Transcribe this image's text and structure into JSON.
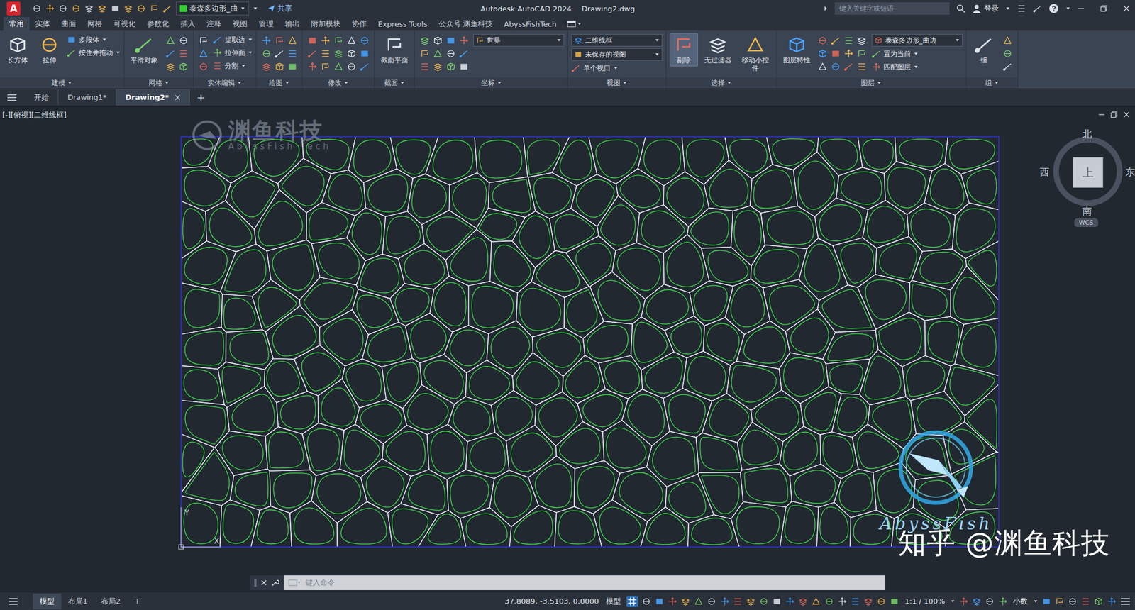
{
  "window": {
    "app_letter": "A",
    "app_title": "Autodesk AutoCAD 2024",
    "document": "Drawing2.dwg"
  },
  "quick_access": {
    "layer": "泰森多边形_曲",
    "share": "共享"
  },
  "search": {
    "placeholder": "键入关键字或短语"
  },
  "account": {
    "label": "登录"
  },
  "ribbon_tabs": [
    {
      "label": "常用",
      "selected": true
    },
    {
      "label": "实体",
      "selected": false
    },
    {
      "label": "曲面",
      "selected": false
    },
    {
      "label": "网格",
      "selected": false
    },
    {
      "label": "可视化",
      "selected": false
    },
    {
      "label": "参数化",
      "selected": false
    },
    {
      "label": "插入",
      "selected": false
    },
    {
      "label": "注释",
      "selected": false
    },
    {
      "label": "视图",
      "selected": false
    },
    {
      "label": "管理",
      "selected": false
    },
    {
      "label": "输出",
      "selected": false
    },
    {
      "label": "附加模块",
      "selected": false
    },
    {
      "label": "协作",
      "selected": false
    },
    {
      "label": "Express Tools",
      "selected": false
    },
    {
      "label": "公众号 渊鱼科技",
      "selected": false
    },
    {
      "label": "AbyssFishTech",
      "selected": false
    }
  ],
  "panels": [
    {
      "title": "建模",
      "tools": [
        {
          "kind": "large",
          "label": "长方体",
          "active": false
        },
        {
          "kind": "large",
          "label": "拉伸",
          "active": false
        },
        {
          "kind": "small",
          "label": "多段体"
        },
        {
          "kind": "small",
          "label": "按住并拖动"
        }
      ]
    },
    {
      "title": "网格",
      "tools": [
        {
          "kind": "large",
          "label": "平滑对象",
          "active": false
        }
      ]
    },
    {
      "title": "实体编辑",
      "tools": [
        {
          "kind": "small",
          "label": "提取边"
        },
        {
          "kind": "small",
          "label": "拉伸面"
        },
        {
          "kind": "small",
          "label": "分割"
        }
      ]
    },
    {
      "title": "绘图",
      "tools": []
    },
    {
      "title": "修改",
      "tools": []
    },
    {
      "title": "截面",
      "tools": [
        {
          "kind": "large",
          "label": "截面平面",
          "active": false
        }
      ]
    },
    {
      "title": "坐标",
      "tools": [
        {
          "kind": "dropdown",
          "label": "世界"
        }
      ]
    },
    {
      "title": "视图",
      "tools": [
        {
          "kind": "dropdown",
          "label": "二维线框"
        },
        {
          "kind": "dropdown",
          "label": "未保存的视图"
        },
        {
          "kind": "small",
          "label": "单个视口"
        }
      ]
    },
    {
      "title": "选择",
      "tools": [
        {
          "kind": "large",
          "label": "剔除",
          "active": true
        },
        {
          "kind": "large",
          "label": "无过滤器",
          "active": false
        },
        {
          "kind": "large",
          "label": "移动小控件",
          "active": false
        }
      ]
    },
    {
      "title": "图层",
      "tools": [
        {
          "kind": "large",
          "label": "图层特性",
          "active": false
        },
        {
          "kind": "dropdown",
          "label": "泰森多边形_曲边"
        },
        {
          "kind": "small",
          "label": "置为当前"
        },
        {
          "kind": "small",
          "label": "匹配图层"
        }
      ]
    },
    {
      "title": "组",
      "tools": [
        {
          "kind": "large",
          "label": "组",
          "active": false
        }
      ]
    }
  ],
  "file_tabs": [
    {
      "label": "开始",
      "selected": false,
      "closable": false
    },
    {
      "label": "Drawing1*",
      "selected": false,
      "closable": false
    },
    {
      "label": "Drawing2*",
      "selected": true,
      "closable": true
    }
  ],
  "new_tab": "+",
  "viewport": {
    "label": "[-][俯视][二维线框]"
  },
  "viewcube": {
    "north": "北",
    "south": "南",
    "west": "西",
    "east": "东",
    "top": "上",
    "ucs": "WCS"
  },
  "ucs_icon": {
    "x": "X",
    "y": "Y"
  },
  "watermarks": {
    "brand_cn": "渊鱼科技",
    "brand_en": "AbyssFish Tech",
    "logo_text": "AbyssFish",
    "zhihu": "知乎 @渊鱼科技"
  },
  "command_line": {
    "placeholder": "键入命令"
  },
  "layout_tabs": [
    {
      "label": "模型",
      "selected": true
    },
    {
      "label": "布局1",
      "selected": false
    },
    {
      "label": "布局2",
      "selected": false
    }
  ],
  "add_layout": "+",
  "status_bar": {
    "coordinates": "37.8089, -3.5103, 0.0000",
    "space": "模型",
    "grid_display": true,
    "scale": "1:1 / 100%",
    "units": "小数"
  }
}
